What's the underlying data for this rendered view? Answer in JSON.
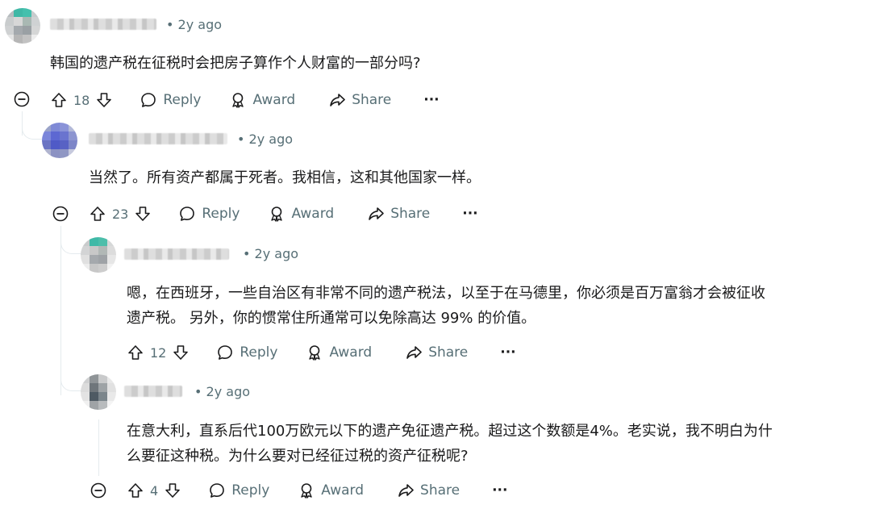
{
  "comments": [
    {
      "id": "c1",
      "time": "• 2y ago",
      "text_lines": [
        "韩国的遗产税在征税时会把房子算作个人财富的一部分吗?"
      ],
      "votes": "18",
      "reply": "Reply",
      "award": "Award",
      "share": "Share",
      "more": "···"
    },
    {
      "id": "c2",
      "time": "• 2y ago",
      "text_lines": [
        "当然了。所有资产都属于死者。我相信，这和其他国家一样。"
      ],
      "votes": "23",
      "reply": "Reply",
      "award": "Award",
      "share": "Share",
      "more": "···"
    },
    {
      "id": "c3",
      "time": "• 2y ago",
      "text_lines": [
        "嗯，在西班牙，一些自治区有非常不同的遗产税法，以至于在马德里，你必须是百万富翁才会被征收",
        "遗产税。 另外，你的惯常住所通常可以免除高达 99% 的价值。"
      ],
      "votes": "12",
      "reply": "Reply",
      "award": "Award",
      "share": "Share",
      "more": "···"
    },
    {
      "id": "c4",
      "time": "• 2y ago",
      "text_lines": [
        "在意大利，直系后代100万欧元以下的遗产免征遗产税。超过这个数额是4%。老实说，我不明白为什",
        "么要征这种税。为什么要对已经征过税的资产征税呢?"
      ],
      "votes": "4",
      "reply": "Reply",
      "award": "Award",
      "share": "Share",
      "more": "···"
    }
  ]
}
